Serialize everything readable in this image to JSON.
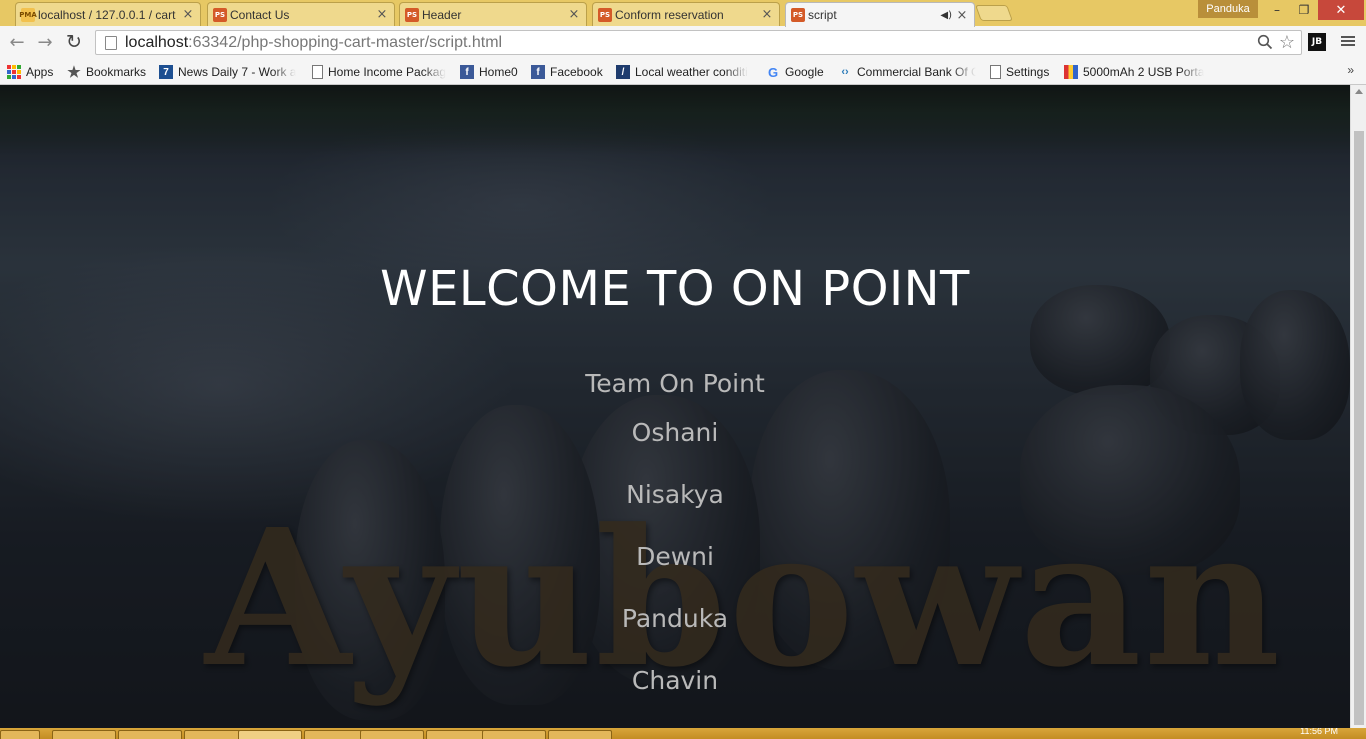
{
  "browser": {
    "tabs": [
      {
        "title": "localhost / 127.0.0.1 / cart",
        "icon": "phpmyadmin-icon",
        "active": false
      },
      {
        "title": "Contact Us",
        "icon": "phpstorm-icon",
        "active": false
      },
      {
        "title": "Header",
        "icon": "phpstorm-icon",
        "active": false
      },
      {
        "title": "Conform reservation",
        "icon": "phpstorm-icon",
        "active": false
      },
      {
        "title": "script",
        "icon": "phpstorm-icon",
        "active": true,
        "audio": true
      }
    ],
    "profile_name": "Panduka",
    "address": {
      "host": "localhost",
      "path": ":63342/php-shopping-cart-master/script.html"
    },
    "bookmarks": [
      {
        "label": "Apps",
        "icon": "apps-grid-icon"
      },
      {
        "label": "Bookmarks",
        "icon": "star-icon"
      },
      {
        "label": "News Daily 7 - Work a",
        "icon": "news7-icon"
      },
      {
        "label": "Home Income Packag",
        "icon": "page-icon"
      },
      {
        "label": "Home0",
        "icon": "facebook-icon"
      },
      {
        "label": "Facebook",
        "icon": "facebook-icon"
      },
      {
        "label": "Local weather conditi",
        "icon": "weather-icon"
      },
      {
        "label": "Google",
        "icon": "google-icon"
      },
      {
        "label": "Commercial Bank Of C",
        "icon": "cbc-icon"
      },
      {
        "label": "Settings",
        "icon": "page-icon"
      },
      {
        "label": "5000mAh 2 USB Porta",
        "icon": "usb-icon"
      }
    ],
    "bookmarks_overflow": "»"
  },
  "page": {
    "title": "WELCOME TO ON POINT",
    "team_heading": "Team On Point",
    "members": [
      "Oshani",
      "Nisakya",
      "Dewni",
      "Panduka",
      "Chavin"
    ],
    "background_watermark": "Ayubowan"
  },
  "taskbar": {
    "clock": "11:56 PM"
  }
}
